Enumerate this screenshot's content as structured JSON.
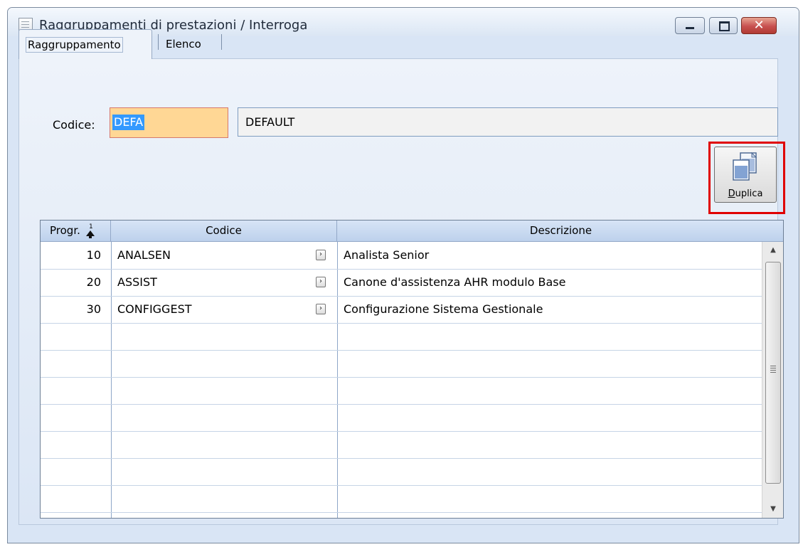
{
  "window": {
    "title": "Raggruppamenti di prestazioni / Interroga",
    "close_glyph": "✕"
  },
  "tabs": [
    {
      "label": "Raggruppamento",
      "active": true
    },
    {
      "label": "Elenco",
      "active": false
    }
  ],
  "form": {
    "codice_label": "Codice:",
    "codice_value": "DEFA",
    "descrizione_value": "DEFAULT"
  },
  "toolbar": {
    "duplica_label": "Duplica",
    "duplica_icon": "copy-documents-icon"
  },
  "grid": {
    "columns": [
      "Progr.",
      "Codice",
      "Descrizione"
    ],
    "sort_indicator": "1",
    "rows": [
      {
        "progr": "10",
        "codice": "ANALSEN",
        "descrizione": "Analista Senior"
      },
      {
        "progr": "20",
        "codice": "ASSIST",
        "descrizione": "Canone d'assistenza AHR modulo Base"
      },
      {
        "progr": "30",
        "codice": "CONFIGGEST",
        "descrizione": "Configurazione Sistema Gestionale"
      }
    ],
    "zoom_glyph": "›"
  },
  "scrollbar": {
    "up": "▲",
    "down": "▼"
  },
  "colors": {
    "window_bg": "#d9e5f5",
    "code_field_bg": "#ffd795",
    "selection": "#3399ff",
    "highlight": "#e00000",
    "close_button": "#c75050"
  }
}
